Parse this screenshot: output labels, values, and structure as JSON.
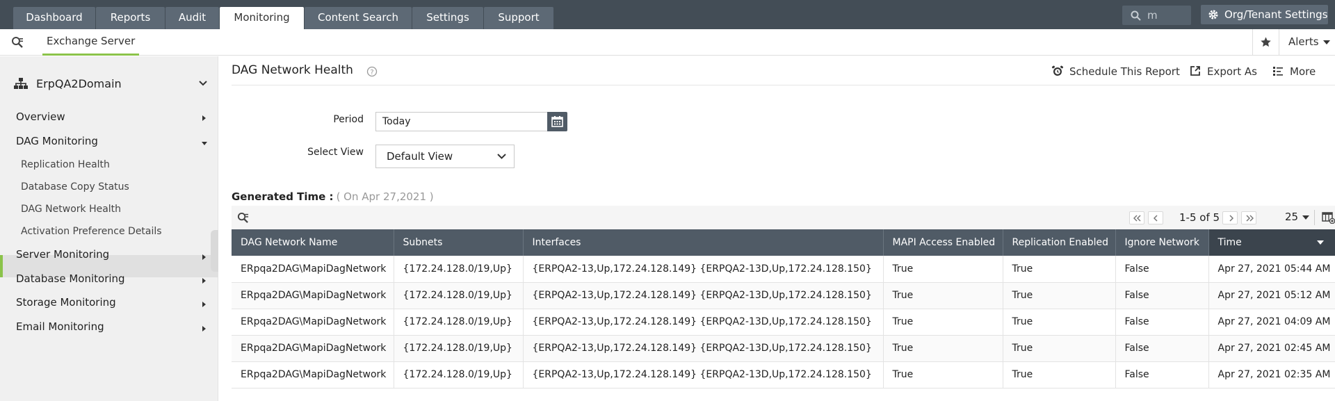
{
  "topnav": {
    "tabs": [
      {
        "label": "Dashboard"
      },
      {
        "label": "Reports"
      },
      {
        "label": "Audit"
      },
      {
        "label": "Monitoring",
        "active": true
      },
      {
        "label": "Content Search"
      },
      {
        "label": "Settings"
      },
      {
        "label": "Support"
      }
    ],
    "search_value": "m",
    "org_settings_label": "Org/Tenant Settings"
  },
  "subnav": {
    "tab_label": "Exchange Server",
    "alerts_label": "Alerts"
  },
  "sidebar": {
    "domain_label": "ErpQA2Domain",
    "items": {
      "overview": "Overview",
      "dag_monitoring": "DAG Monitoring",
      "replication_health": "Replication Health",
      "database_copy_status": "Database Copy Status",
      "dag_network_health": "DAG Network Health",
      "activation_preference_details": "Activation Preference Details",
      "server_monitoring": "Server Monitoring",
      "database_monitoring": "Database Monitoring",
      "storage_monitoring": "Storage Monitoring",
      "email_monitoring": "Email Monitoring"
    }
  },
  "main": {
    "title": "DAG Network Health",
    "actions": {
      "schedule": "Schedule This Report",
      "export": "Export As",
      "more": "More"
    },
    "form": {
      "period_label": "Period",
      "period_value": "Today",
      "view_label": "Select View",
      "view_value": "Default View"
    },
    "generated": {
      "label": "Generated Time :",
      "value": "( On Apr 27,2021 )"
    },
    "pagination": {
      "range_text": "1-5 of 5",
      "per_page": "25"
    },
    "table": {
      "columns": [
        "DAG Network Name",
        "Subnets",
        "Interfaces",
        "MAPI Access Enabled",
        "Replication Enabled",
        "Ignore Network",
        "Time"
      ],
      "rows": [
        [
          "ERpqa2DAG\\MapiDagNetwork",
          "{172.24.128.0/19,Up}",
          "{ERPQA2-13,Up,172.24.128.149} {ERPQA2-13D,Up,172.24.128.150}",
          "True",
          "True",
          "False",
          "Apr 27, 2021 05:44 AM"
        ],
        [
          "ERpqa2DAG\\MapiDagNetwork",
          "{172.24.128.0/19,Up}",
          "{ERPQA2-13,Up,172.24.128.149} {ERPQA2-13D,Up,172.24.128.150}",
          "True",
          "True",
          "False",
          "Apr 27, 2021 05:12 AM"
        ],
        [
          "ERpqa2DAG\\MapiDagNetwork",
          "{172.24.128.0/19,Up}",
          "{ERPQA2-13,Up,172.24.128.149} {ERPQA2-13D,Up,172.24.128.150}",
          "True",
          "True",
          "False",
          "Apr 27, 2021 04:09 AM"
        ],
        [
          "ERpqa2DAG\\MapiDagNetwork",
          "{172.24.128.0/19,Up}",
          "{ERPQA2-13,Up,172.24.128.149} {ERPQA2-13D,Up,172.24.128.150}",
          "True",
          "True",
          "False",
          "Apr 27, 2021 02:45 AM"
        ],
        [
          "ERpqa2DAG\\MapiDagNetwork",
          "{172.24.128.0/19,Up}",
          "{ERPQA2-13,Up,172.24.128.149} {ERPQA2-13D,Up,172.24.128.150}",
          "True",
          "True",
          "False",
          "Apr 27, 2021 02:35 AM"
        ]
      ]
    }
  },
  "colors": {
    "topbar": "#434d56",
    "tab": "#5d6975",
    "accent": "#8bc34a",
    "table_header": "#505b66"
  },
  "icons": [
    "search-icon",
    "gear-icon",
    "star-icon",
    "org-tree-icon",
    "help-icon",
    "alarm-clock-icon",
    "export-icon",
    "more-icon",
    "calendar-icon",
    "chevron-down-icon",
    "first-page-icon",
    "prev-page-icon",
    "next-page-icon",
    "last-page-icon",
    "column-chooser-icon"
  ]
}
